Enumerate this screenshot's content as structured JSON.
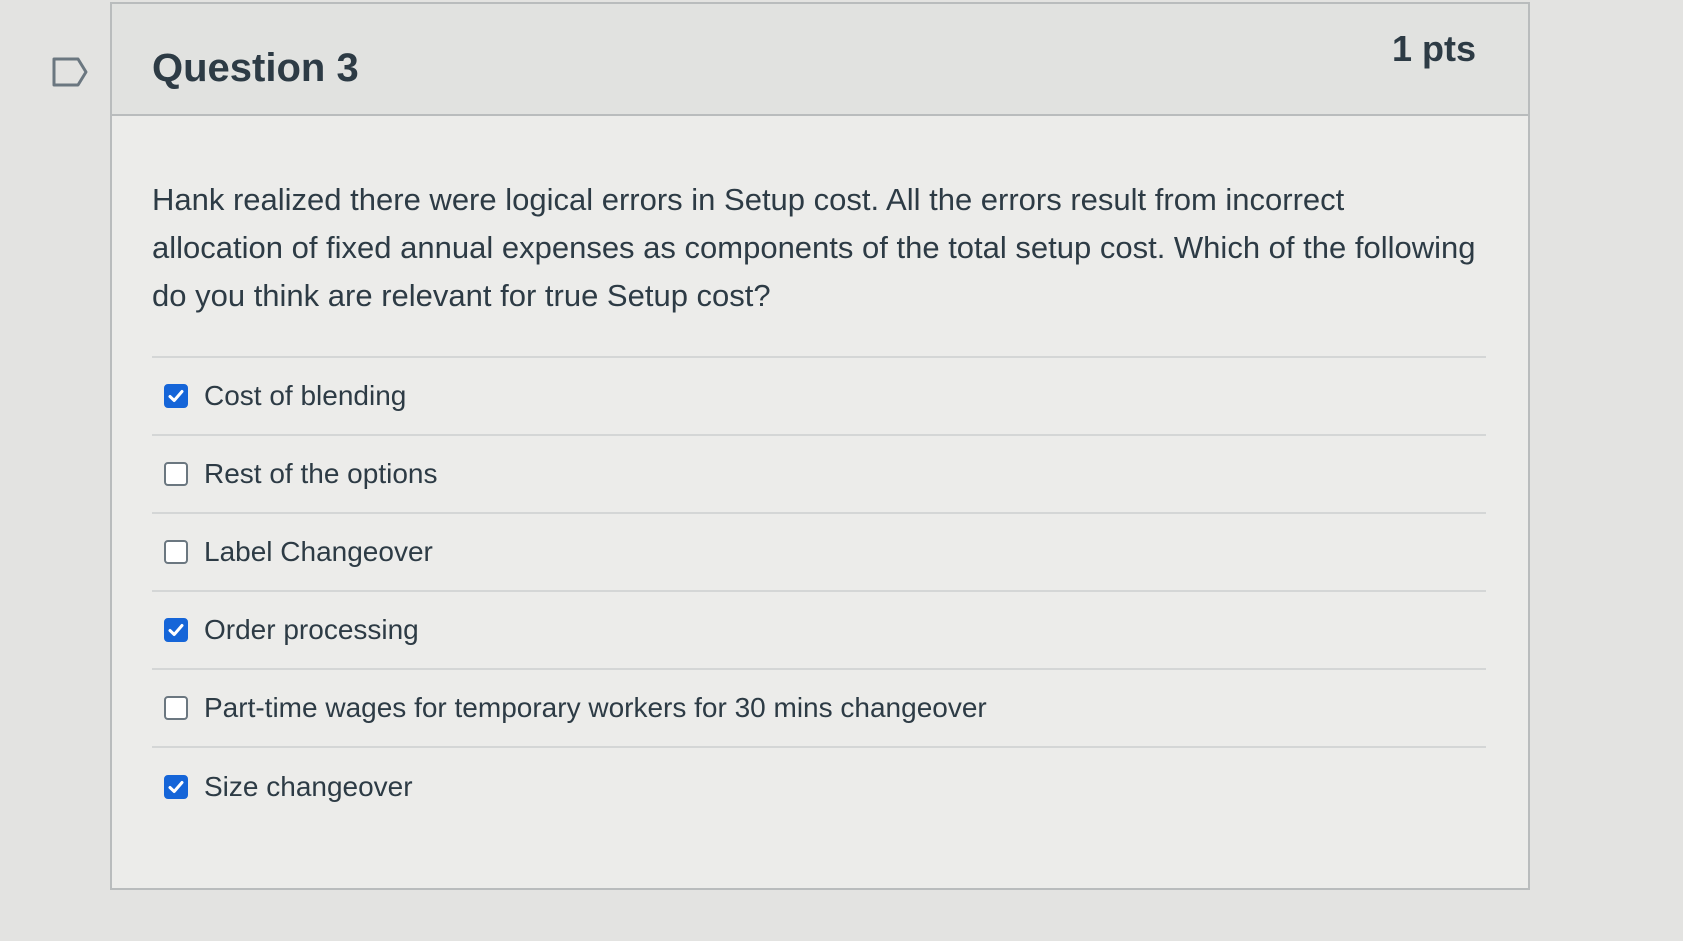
{
  "question": {
    "title": "Question 3",
    "points": "1 pts",
    "text": "Hank realized there were logical errors in  Setup cost. All the errors result from incorrect allocation of fixed annual expenses as components of the total setup cost. Which of the following do you think are relevant for true Setup cost?",
    "flag_icon": "flag-outline-icon",
    "answers": [
      {
        "label": "Cost of blending",
        "checked": true
      },
      {
        "label": "Rest of the options",
        "checked": false
      },
      {
        "label": "Label Changeover",
        "checked": false
      },
      {
        "label": "Order processing",
        "checked": true
      },
      {
        "label": "Part-time wages for temporary workers for 30 mins changeover",
        "checked": false
      },
      {
        "label": "Size changeover",
        "checked": true
      }
    ]
  },
  "colors": {
    "checkbox_checked": "#1565d8",
    "text": "#2d3b45"
  }
}
